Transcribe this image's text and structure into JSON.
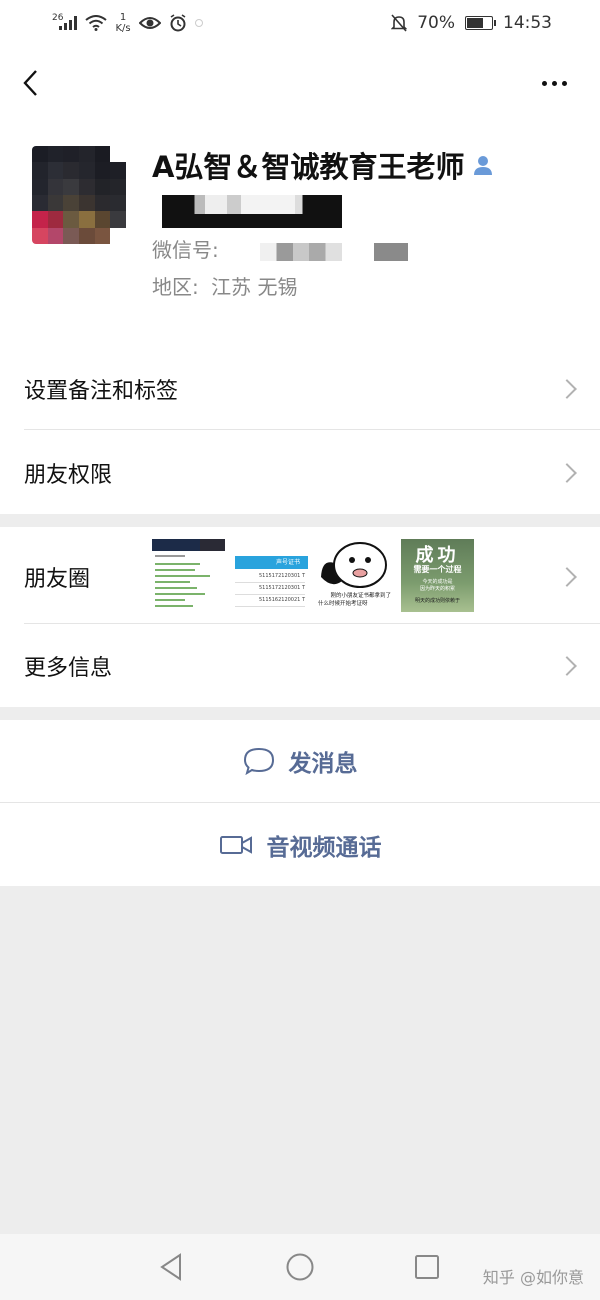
{
  "status_bar": {
    "signal_label": "26",
    "speed_value": "1",
    "speed_unit": "K/s",
    "battery_percent": "70%",
    "battery_level": 0.7,
    "time": "14:53"
  },
  "header": {
    "name": "A弘智＆智诚教育王老师",
    "wechat_id_label": "微信号:",
    "region_label": "地区:",
    "region_value": "江苏  无锡"
  },
  "menu": {
    "set_remark": "设置备注和标签",
    "friend_permissions": "朋友权限",
    "moments": "朋友圈",
    "more_info": "更多信息"
  },
  "moments_thumbs": {
    "t2_header": "声号证书",
    "t2_rows": [
      "5115172120301 T",
      "5115172120301 T",
      "5115162120021 T"
    ],
    "t3_caption1": "刚的小朋友证书都拿到了",
    "t3_caption2": "什么时候开始考证呀",
    "t4_title": "成功",
    "t4_sub": "需要一个过程",
    "t4_line1": "今天的成功是",
    "t4_line2": "因为昨天的积累",
    "t4_line3": "明天的成功则依赖于"
  },
  "actions": {
    "send_message": "发消息",
    "video_call": "音视频通话"
  },
  "watermark": "知乎 @如你意",
  "colors": {
    "link_blue": "#576b95",
    "background": "#ededed"
  }
}
